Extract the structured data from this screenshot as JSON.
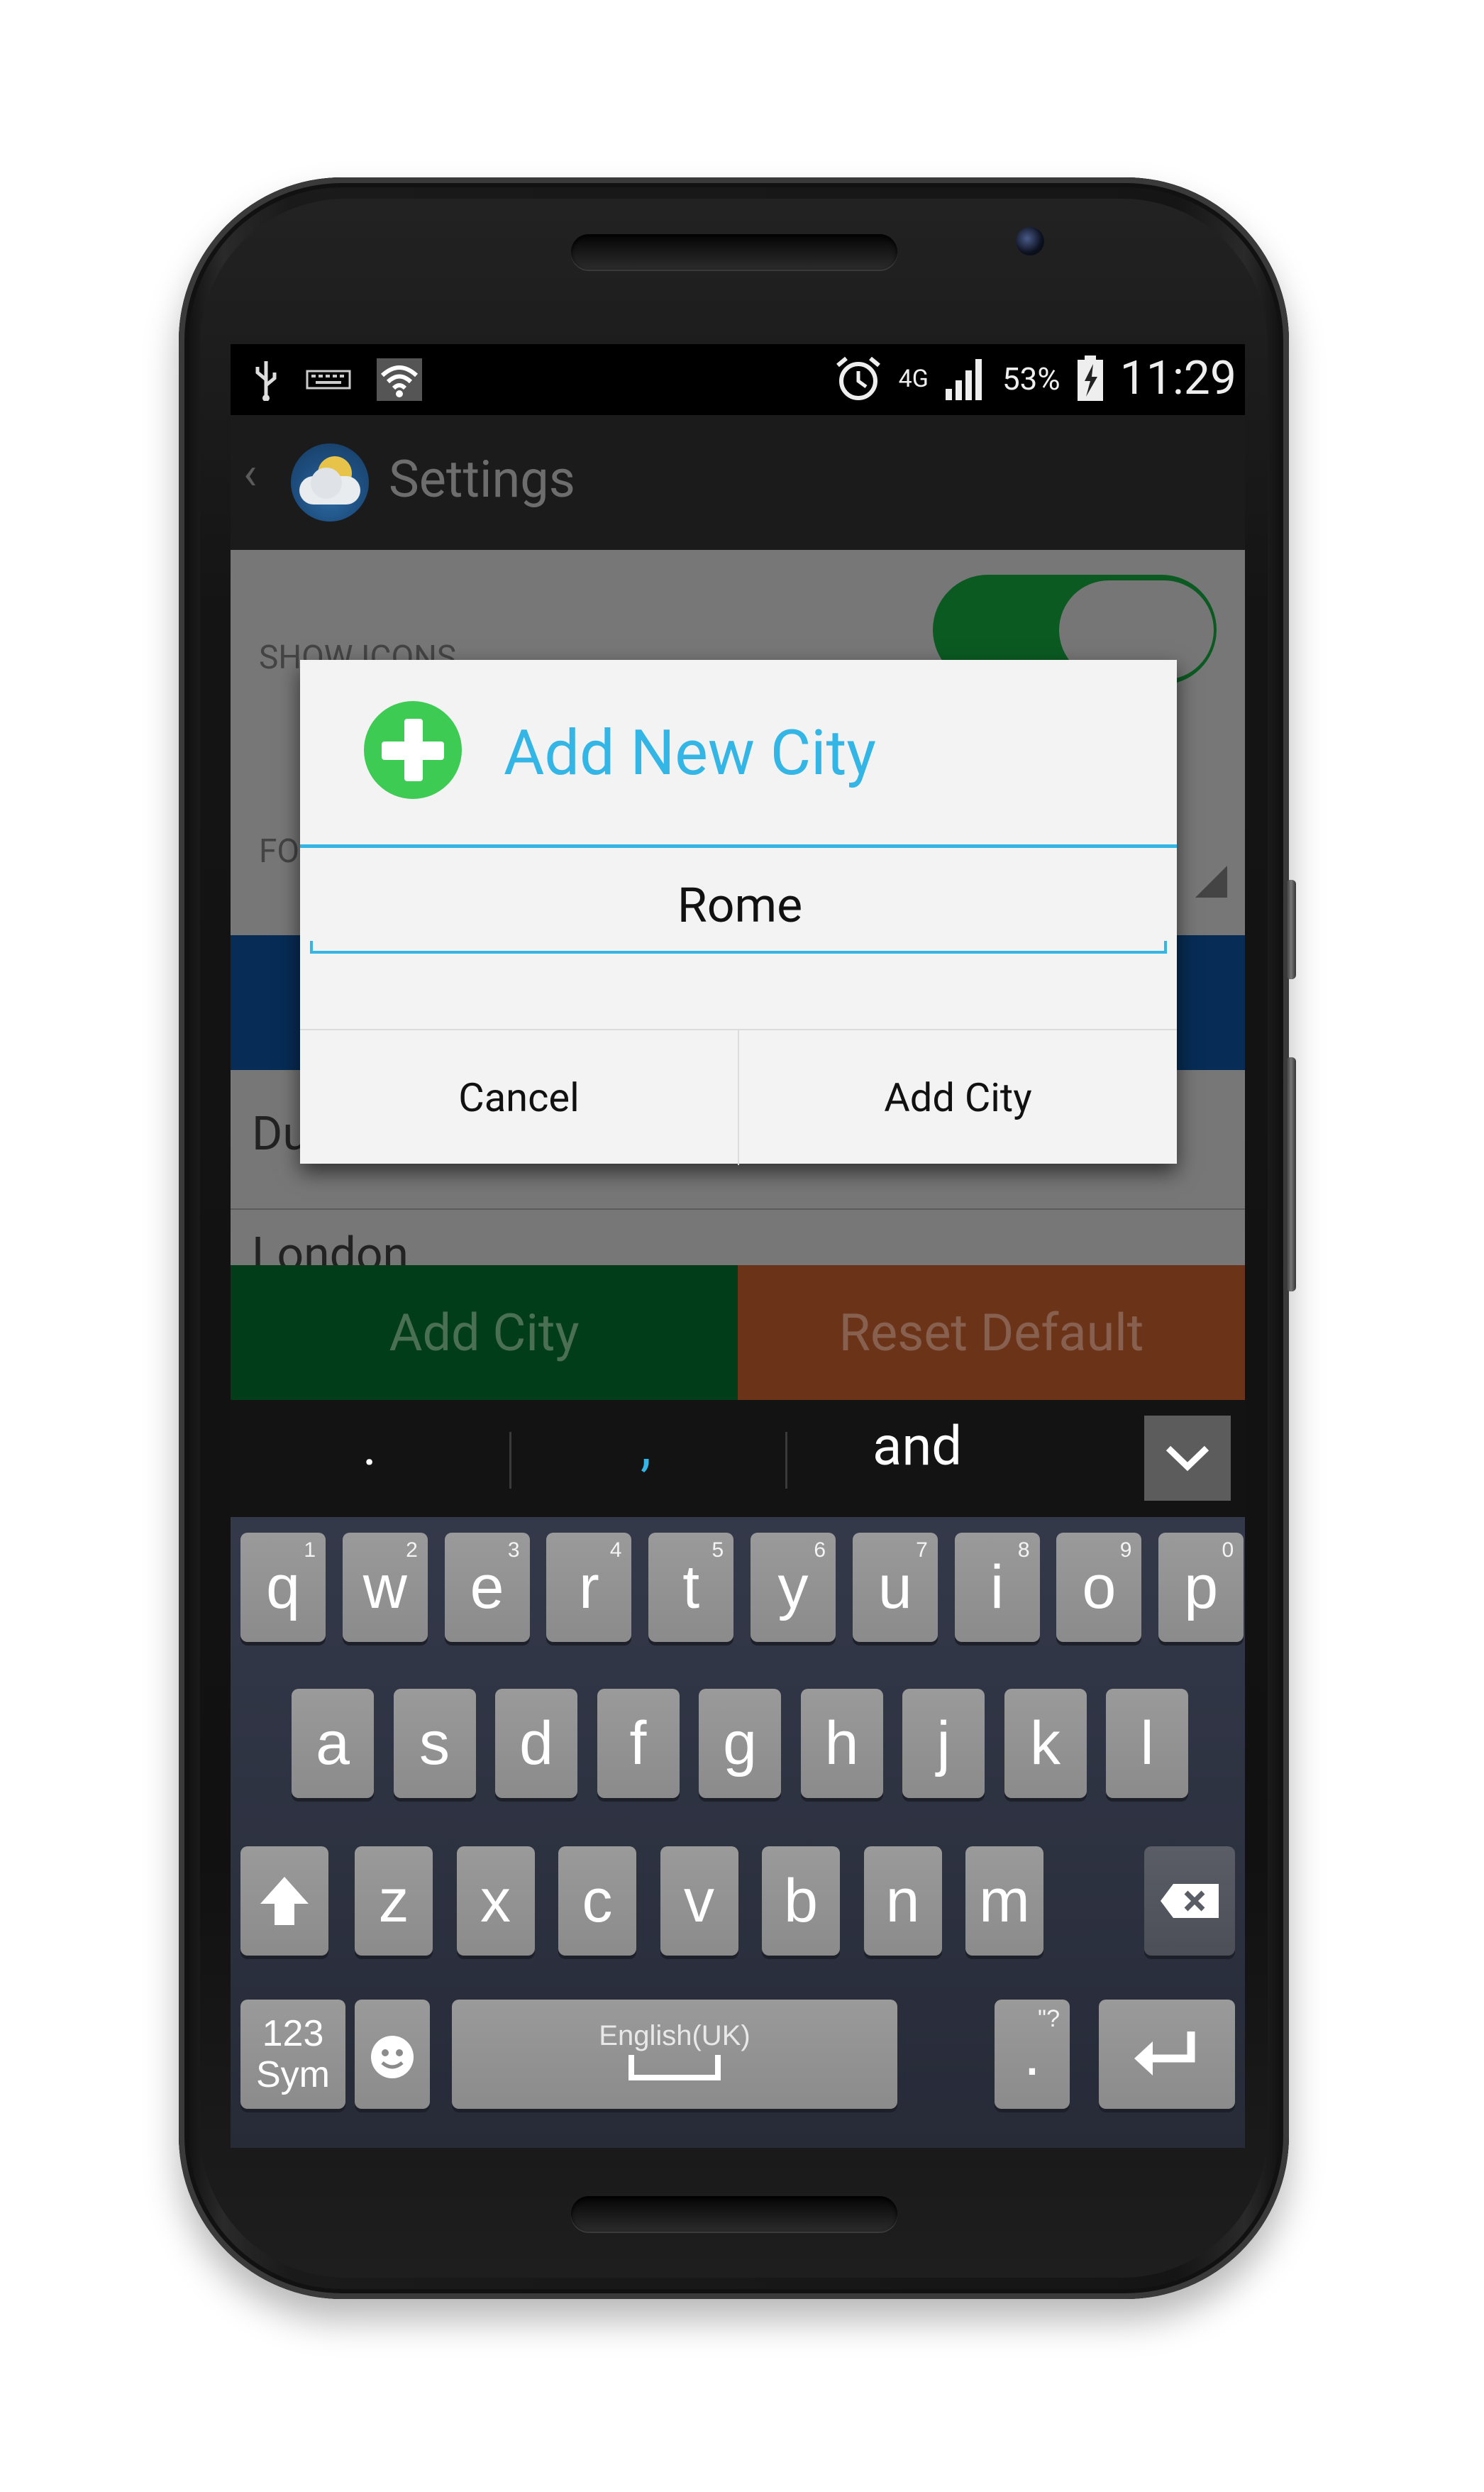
{
  "status_bar": {
    "battery": "53%",
    "network": "4G",
    "time": "11:29"
  },
  "action_bar": {
    "title": "Settings"
  },
  "settings": {
    "show_icons_label": "SHOW ICONS",
    "font_label": "FO",
    "list_items": [
      "Dublin",
      "London"
    ]
  },
  "bottom_buttons": {
    "add": "Add City",
    "reset": "Reset Default"
  },
  "dialog": {
    "title": "Add New City",
    "input_value": "Rome",
    "cancel": "Cancel",
    "confirm": "Add City"
  },
  "suggestions": {
    "items": [
      ".",
      ",",
      "and"
    ]
  },
  "keyboard": {
    "row1": [
      {
        "k": "q",
        "n": "1"
      },
      {
        "k": "w",
        "n": "2"
      },
      {
        "k": "e",
        "n": "3"
      },
      {
        "k": "r",
        "n": "4"
      },
      {
        "k": "t",
        "n": "5"
      },
      {
        "k": "y",
        "n": "6"
      },
      {
        "k": "u",
        "n": "7"
      },
      {
        "k": "i",
        "n": "8"
      },
      {
        "k": "o",
        "n": "9"
      },
      {
        "k": "p",
        "n": "0"
      }
    ],
    "row2": [
      "a",
      "s",
      "d",
      "f",
      "g",
      "h",
      "j",
      "k",
      "l"
    ],
    "row3": [
      "z",
      "x",
      "c",
      "v",
      "b",
      "n",
      "m"
    ],
    "sym_label_1": "123",
    "sym_label_2": "Sym",
    "space_label": "English(UK)",
    "period_key": ".",
    "period_hint": "\"?"
  }
}
